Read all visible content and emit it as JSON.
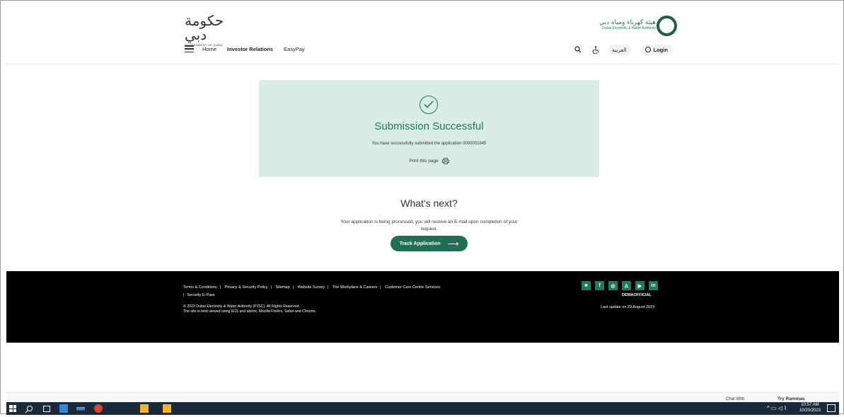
{
  "header": {
    "gov_logo_text": "حكومة دبي",
    "gov_logo_sub": "GOVERNMENT OF DUBAI",
    "dewa_ar": "هيئة كهرباء ومياه دبي",
    "dewa_en": "Dubai Electricity & Water Authority",
    "nav": [
      "Home",
      "Investor Relations",
      "EasyPay"
    ],
    "lang": "العربية",
    "login": "Login"
  },
  "success": {
    "title": "Submission Successful",
    "message": "You have successfully submitted the application 0000001945",
    "print": "Print this page"
  },
  "next": {
    "title": "What's next?",
    "text": "Your application is being processed, you will receive an E-mail upon completion of your request.",
    "button": "Track Application"
  },
  "footer": {
    "links": [
      "Terms & Conditions",
      "Privacy & Security Policy",
      "Sitemap",
      "Website Survey",
      "The Workplace & Careers",
      "Customer Care Centre Services",
      "Security E-Pass"
    ],
    "copyright": "© 2023 Dubai Electricity & Water Authority (PJSC). All Rights Reserved.",
    "browser_note": "The site is best viewed using IE11 and above, Mozilla Firefox, Safari and Chrome.",
    "handle": "DEWAOFFICIAL",
    "last_update": "Last update on 29 August 2023"
  },
  "taskbar": {
    "time": "10:57 AM",
    "date": "10/20/2023"
  },
  "overlay": {
    "chat": "Chat With",
    "rammas": "Try Rammas"
  },
  "colors": {
    "accent": "#1f7a5e",
    "card_bg": "#d9ede5",
    "footer_bg": "#000000"
  }
}
